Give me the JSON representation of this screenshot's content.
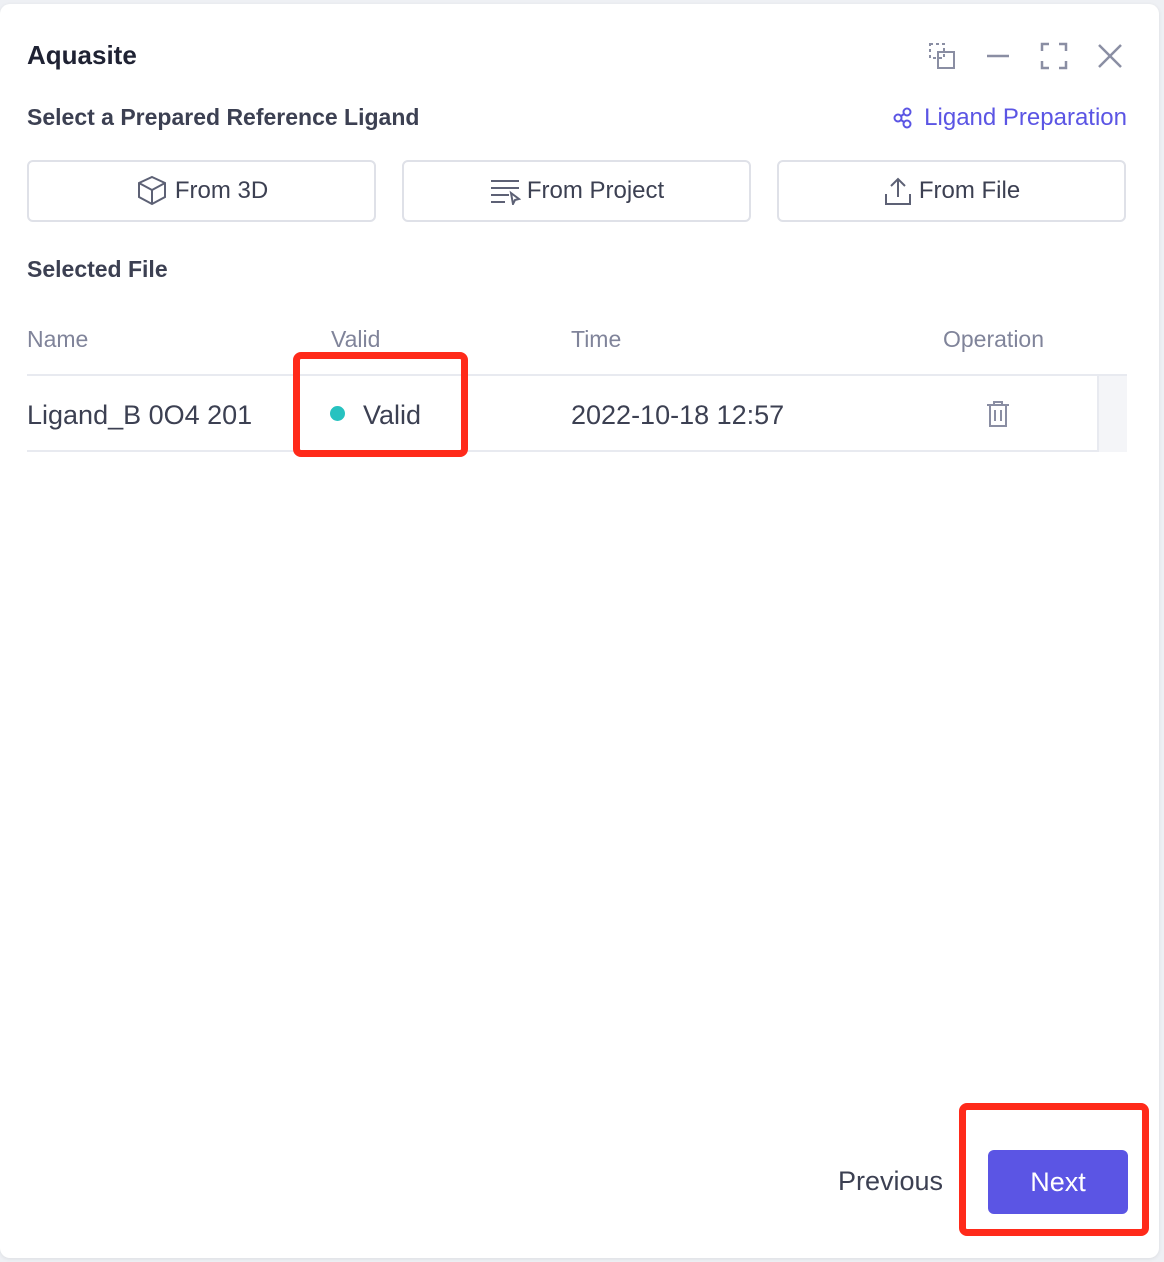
{
  "app": {
    "title": "Aquasite"
  },
  "window_controls": [
    "restore-icon",
    "minimize-icon",
    "maximize-icon",
    "close-icon"
  ],
  "reference": {
    "label": "Select a Prepared Reference Ligand",
    "prep_link": "Ligand Preparation",
    "sources": [
      {
        "label": "From 3D",
        "icon": "cube-icon"
      },
      {
        "label": "From Project",
        "icon": "list-icon"
      },
      {
        "label": "From File",
        "icon": "upload-icon"
      }
    ]
  },
  "selected": {
    "label": "Selected File",
    "columns": [
      "Name",
      "Valid",
      "Time",
      "Operation"
    ],
    "rows": [
      {
        "name": "Ligand_B 0O4 201",
        "valid": "Valid",
        "time": "2022-10-18 12:57",
        "operation_icon": "trash-icon"
      }
    ]
  },
  "footer": {
    "previous": "Previous",
    "next": "Next"
  },
  "colors": {
    "accent": "#5b55e4",
    "valid_dot": "#27c2c0",
    "highlight": "#ff2a1a"
  }
}
